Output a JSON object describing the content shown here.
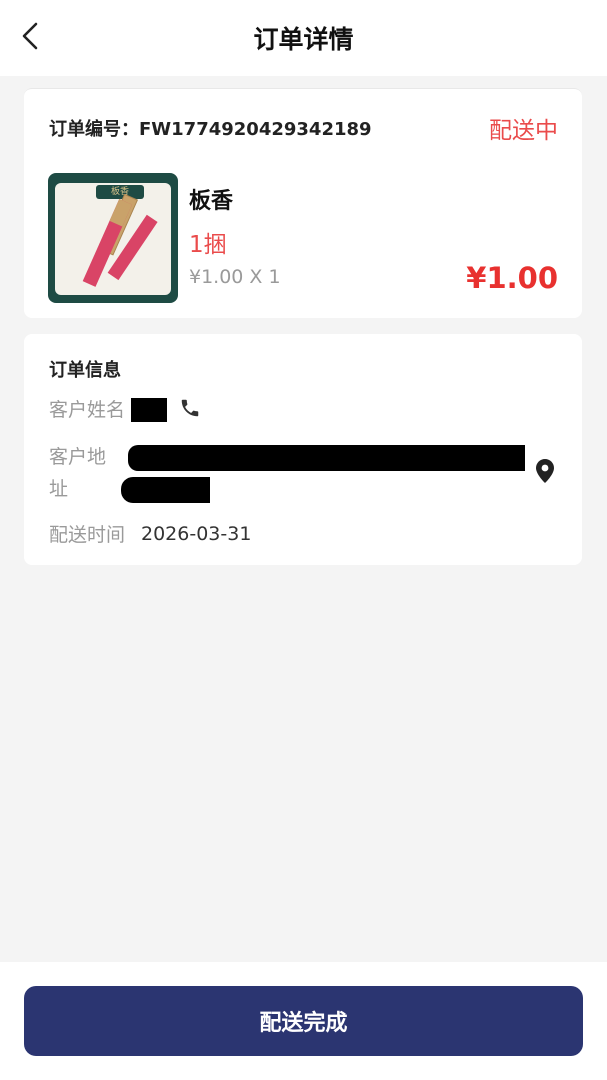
{
  "header": {
    "title": "订单详情"
  },
  "order": {
    "number_label": "订单编号：FW1774920429342189",
    "status": "配送中",
    "product": {
      "thumb_tab": "板香",
      "name": "板香",
      "spec": "1捆",
      "price_qty": "¥1.00 X 1",
      "total": "¥1.00"
    }
  },
  "info": {
    "title": "订单信息",
    "customer_name_label": "客户姓名",
    "address_label_line1": "客户地",
    "address_label_line2": "址",
    "delivery_time_label": "配送时间",
    "delivery_time": "2026-03-31"
  },
  "footer": {
    "complete_button": "配送完成"
  },
  "colors": {
    "accent": "#2b3571",
    "status_red": "#ea4b4b",
    "price_red": "#e8312f"
  },
  "icons": [
    "chevron-left-icon",
    "phone-icon",
    "location-pin-icon"
  ]
}
